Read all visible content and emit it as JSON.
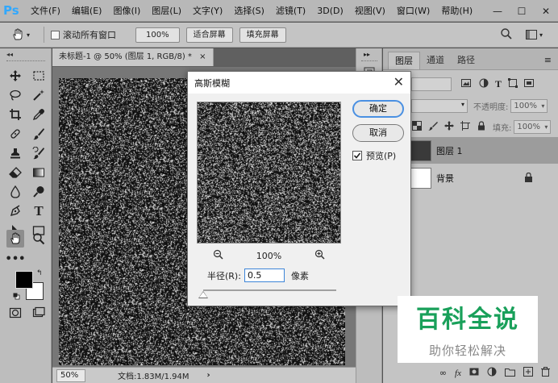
{
  "app": {
    "logo": "Ps",
    "accent": "#31a8ff"
  },
  "menu": [
    "文件(F)",
    "编辑(E)",
    "图像(I)",
    "图层(L)",
    "文字(Y)",
    "选择(S)",
    "滤镜(T)",
    "3D(D)",
    "视图(V)",
    "窗口(W)",
    "帮助(H)"
  ],
  "window_controls": [
    "—",
    "☐",
    "✕"
  ],
  "options_bar": {
    "tool_icon": "hand-icon",
    "scroll_all_label": "滚动所有窗口",
    "zoom_value": "100%",
    "fit_screen": "适合屏幕",
    "fill_screen": "填充屏幕"
  },
  "document": {
    "tab_title": "未标题-1 @ 50% (图层 1, RGB/8) *",
    "tab_close": "×",
    "status_zoom": "50%",
    "status_doc": "文档:1.83M/1.94M",
    "status_arrow": "›"
  },
  "layers_panel": {
    "tabs": [
      "图层",
      "通道",
      "路径"
    ],
    "opacity_label": "不透明度:",
    "opacity_value": "100%",
    "fill_label": "填充:",
    "fill_value": "100%",
    "layers": [
      {
        "name": "图层 1",
        "selected": true
      },
      {
        "name": "背景",
        "locked": true
      }
    ]
  },
  "dialog": {
    "title": "高斯模糊",
    "close": "✕",
    "ok": "确定",
    "cancel": "取消",
    "preview_label": "预览(P)",
    "preview_checked": true,
    "zoom_percent": "100%",
    "radius_label": "半径(R):",
    "radius_value": "0.5",
    "radius_unit": "像素",
    "radius_slider_fraction": 0.0
  },
  "watermark": {
    "line1": "百科全说",
    "line2": "助你轻松解决",
    "color": "#19a05a"
  }
}
